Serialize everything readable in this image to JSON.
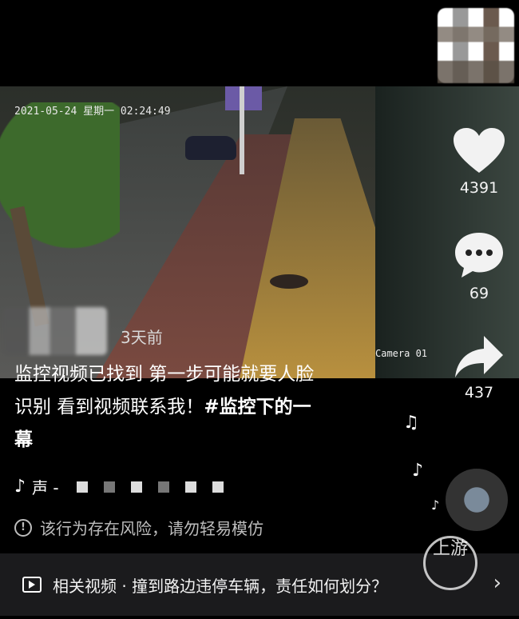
{
  "video": {
    "timestamp": "2021-05-24 星期一 02:24:49",
    "camera_label": "Camera 01"
  },
  "actions": {
    "likes": "4391",
    "comments": "69",
    "shares": "437"
  },
  "post": {
    "time_ago": "3天前",
    "caption_line1": "监控视频已找到 第一步可能就要人脸",
    "caption_line2_plain": "识别 看到视频联系我！",
    "caption_tag_inline": "#监控下的一",
    "caption_line3": "幕"
  },
  "music": {
    "label": "声 -"
  },
  "warning": {
    "text": "该行为存在风险，请勿轻易模仿"
  },
  "related": {
    "text": "相关视频 · 撞到路边违停车辆，责任如何划分？"
  },
  "watermark": {
    "text": "上游"
  },
  "icons": [
    "heart-icon",
    "comment-icon",
    "share-icon",
    "tiktok-note-icon",
    "warning-icon",
    "video-icon",
    "chevron-right-icon"
  ]
}
